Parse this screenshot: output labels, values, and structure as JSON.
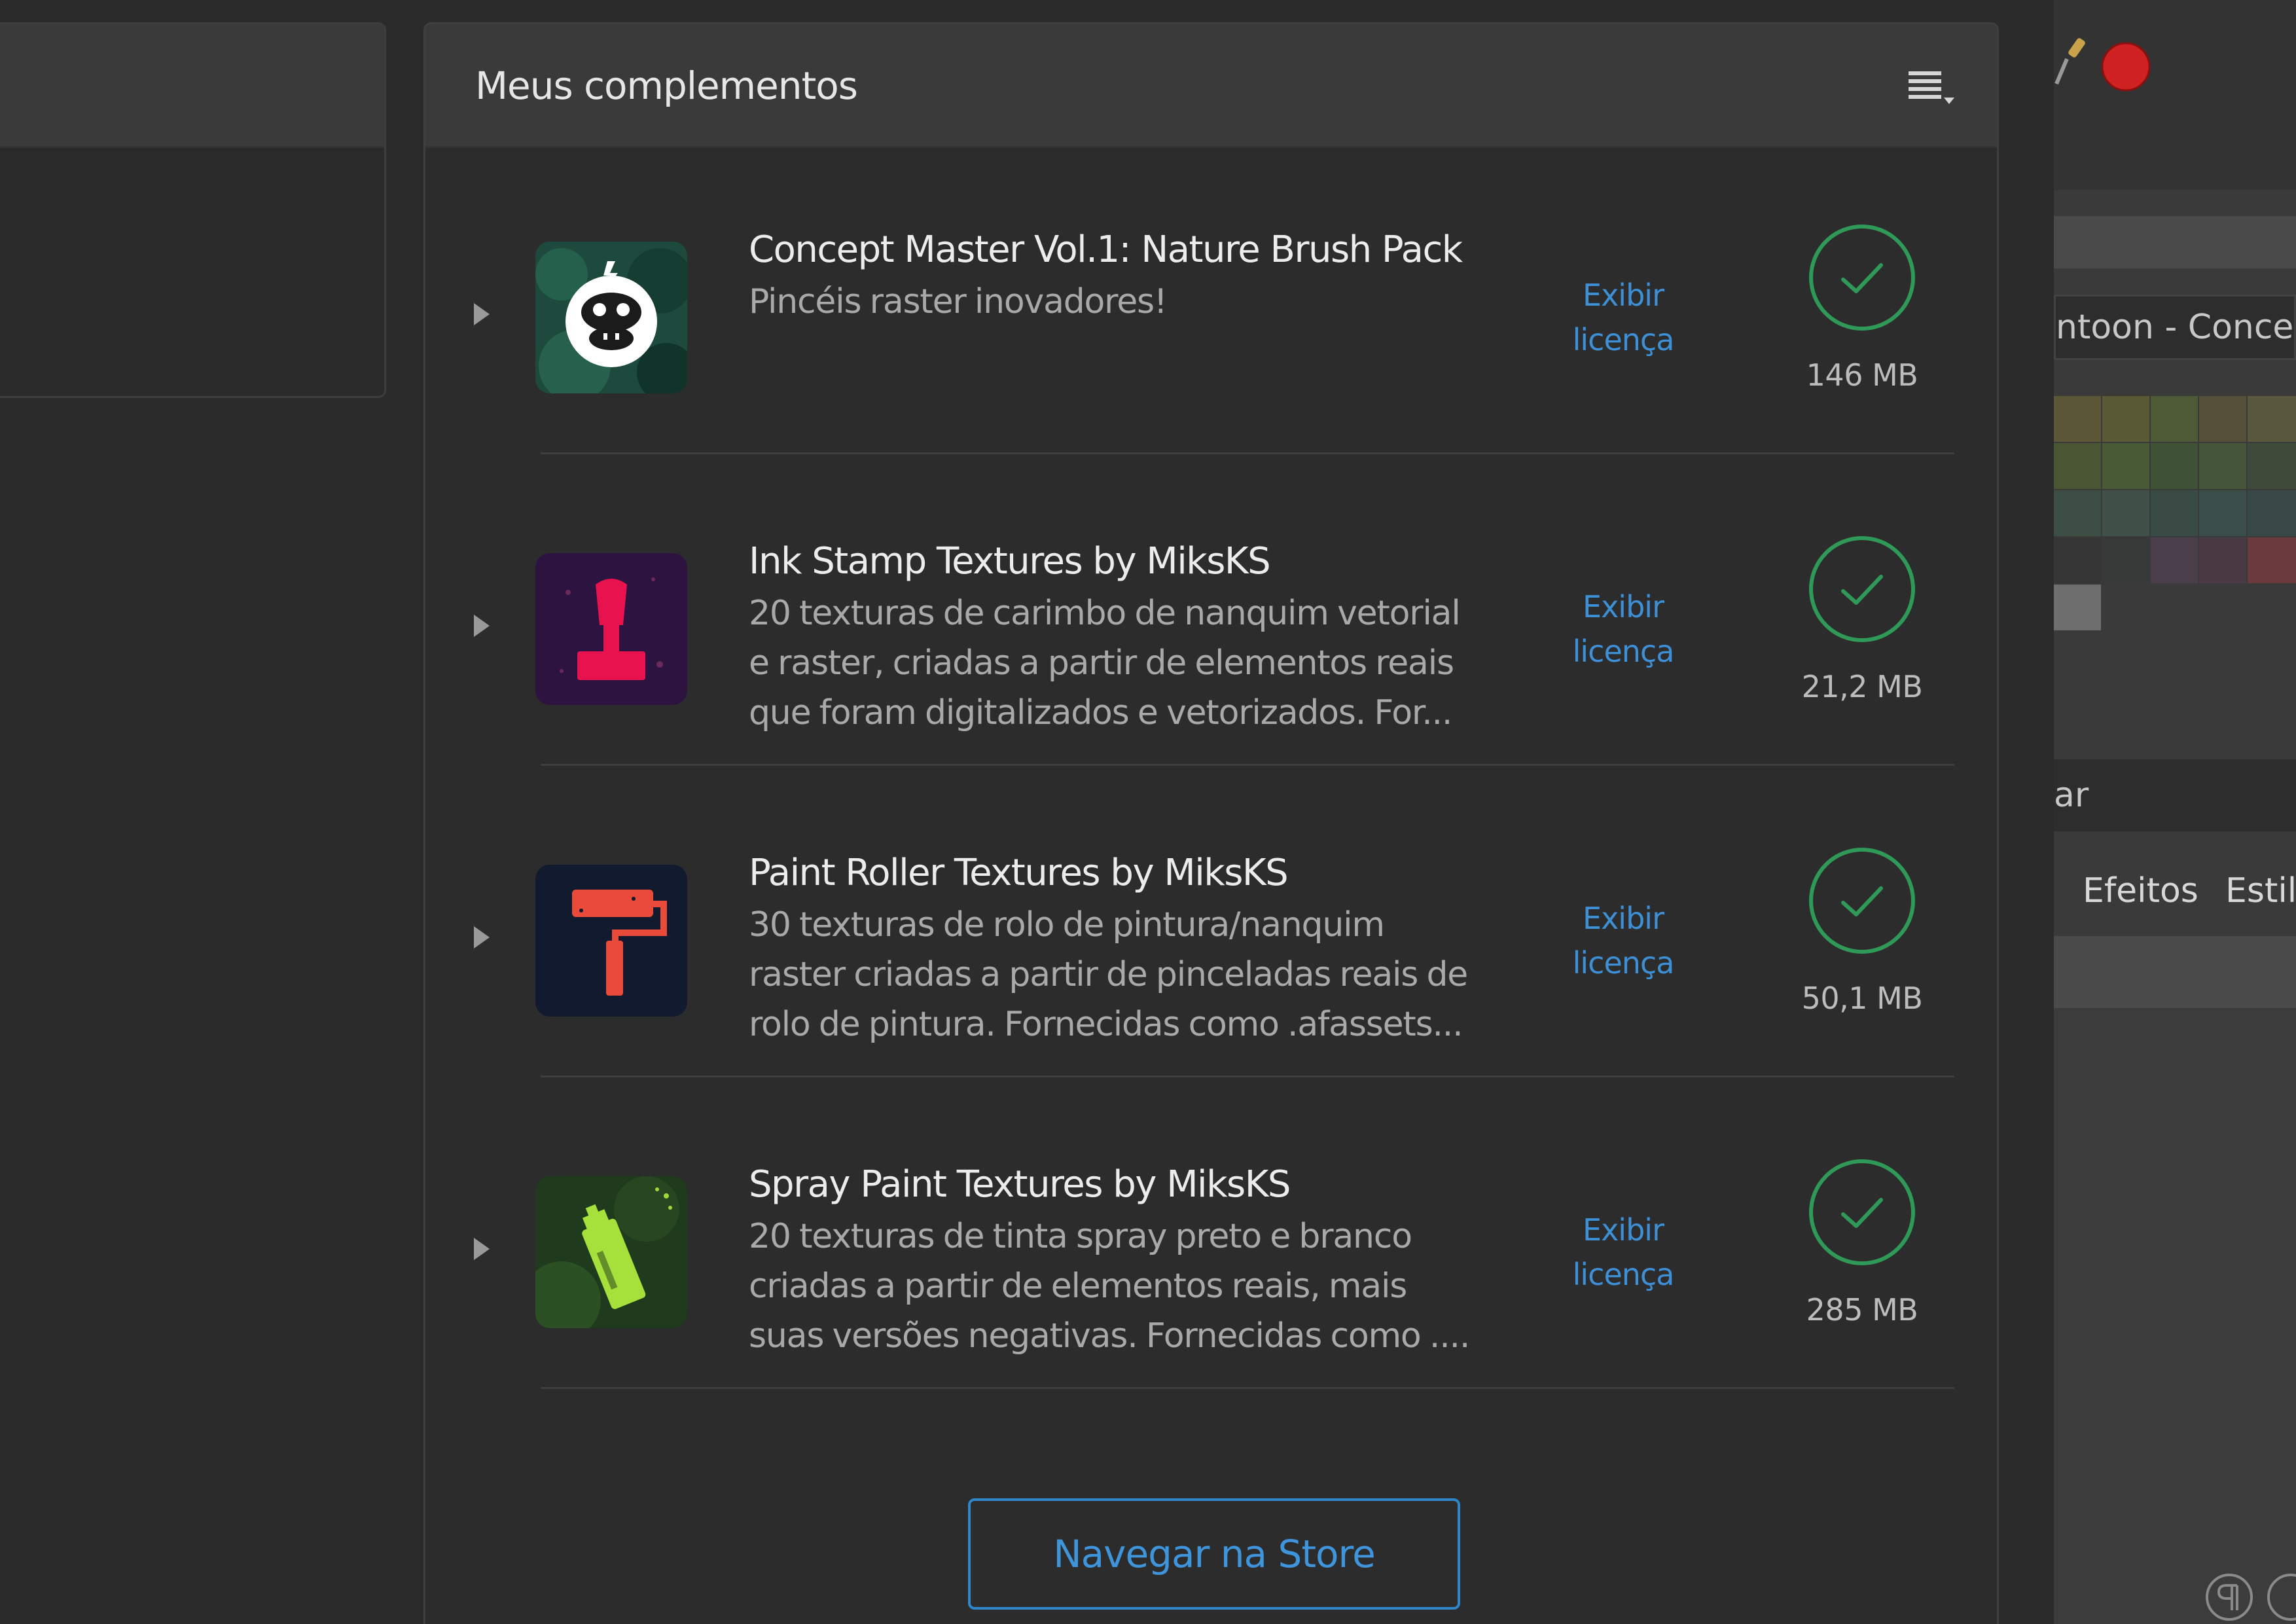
{
  "panel": {
    "title": "Meus complementos",
    "menu_icon": "list-menu-icon"
  },
  "items": [
    {
      "title": "Concept Master Vol.1: Nature Brush Pack",
      "description": "Pincéis raster inovadores!",
      "license_link": "Exibir\nlicença",
      "size": "146 MB",
      "status": "installed",
      "icon": "gorilla-brush-pack-icon"
    },
    {
      "title": "Ink Stamp Textures by MiksKS",
      "description": "20 texturas de carimbo de nanquim vetorial\ne raster, criadas a partir de elementos reais\nque foram digitalizados e vetorizados. For...",
      "license_link": "Exibir\nlicença",
      "size": "21,2 MB",
      "status": "installed",
      "icon": "ink-stamp-icon"
    },
    {
      "title": "Paint Roller Textures by MiksKS",
      "description": "30 texturas de rolo de pintura/nanquim\nraster criadas a partir de pinceladas reais de\nrolo de pintura. Fornecidas como .afassets...",
      "license_link": "Exibir\nlicença",
      "size": "50,1 MB",
      "status": "installed",
      "icon": "paint-roller-icon"
    },
    {
      "title": "Spray Paint Textures by MiksKS",
      "description": "20 texturas de tinta spray preto e branco\ncriadas a partir de elementos reais, mais\nsuas versões negativas. Fornecidas como ....",
      "license_link": "Exibir\nlicença",
      "size": "285 MB",
      "status": "installed",
      "icon": "spray-can-icon"
    }
  ],
  "store_button": "Navegar na Store",
  "right_panel": {
    "field_text": "ntoon - Concep",
    "search_text": "ar",
    "tabs": [
      "Efeitos",
      "Estil"
    ]
  },
  "colors": {
    "accent": "#3d8fd6",
    "installed": "#2f9a58",
    "record": "#d02222"
  }
}
